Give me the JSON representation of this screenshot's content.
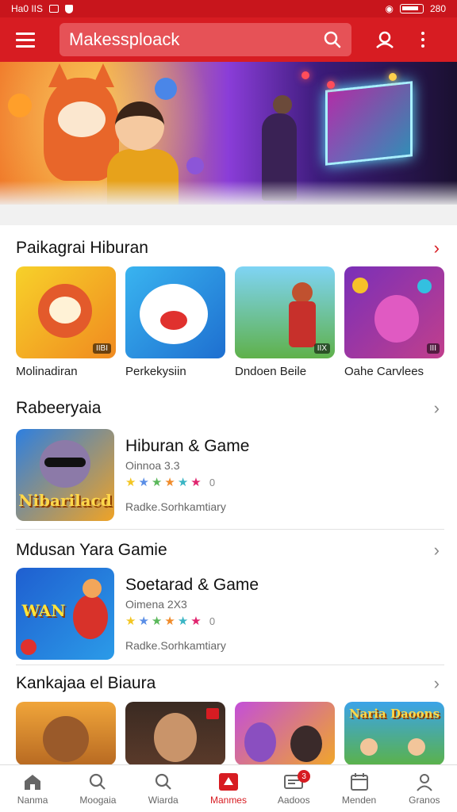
{
  "status_bar": {
    "left_text": "Ha0 IIS",
    "right_text": "280"
  },
  "search": {
    "text": "Makessploack"
  },
  "sections": [
    {
      "title": "Paikagrai Hiburan",
      "chevron_color": "#d71c22",
      "tiles": [
        {
          "label": "Molinadiran",
          "tag": "IIBI"
        },
        {
          "label": "Perkekysiin",
          "tag": ""
        },
        {
          "label": "Dndoen Beile",
          "tag": "IIX"
        },
        {
          "label": "Oahe Carvlees",
          "tag": "III"
        }
      ]
    },
    {
      "title": "Rabeeryaia",
      "item": {
        "title": "Hiburan & Game",
        "sub": "Oinnoa 3.3",
        "stars": "★★★★★★",
        "rating": "0",
        "meta": "Radke.Sorhkamtiary",
        "thumb_word": "Nibarilacd"
      }
    },
    {
      "title": "Mdusan Yara Gamie",
      "item": {
        "title": "Soetarad & Game",
        "sub": "Oimena 2X3",
        "stars": "★★★★★★",
        "rating": "0",
        "meta": "Radke.Sorhkamtiary",
        "thumb_word": "WAN"
      }
    },
    {
      "title": "Kankajaa el Biaura",
      "tiles": [
        {
          "label": ""
        },
        {
          "label": ""
        },
        {
          "label": ""
        },
        {
          "label": "",
          "word": "Naria Daoons"
        }
      ]
    }
  ],
  "bottom_nav": [
    {
      "label": "Nanma",
      "icon": "home-icon"
    },
    {
      "label": "Moogaia",
      "icon": "search-icon"
    },
    {
      "label": "Wiarda",
      "icon": "search-icon"
    },
    {
      "label": "Manmes",
      "icon": "games-icon",
      "active": true
    },
    {
      "label": "Aadoos",
      "icon": "inbox-icon",
      "badge": "3"
    },
    {
      "label": "Menden",
      "icon": "calendar-icon"
    },
    {
      "label": "Granos",
      "icon": "profile-icon"
    }
  ],
  "colors": {
    "brand_red": "#d71c22",
    "star_colors": [
      "#f3c623",
      "#5a8ee6",
      "#5bb85b",
      "#f08b2a",
      "#3ab5c4",
      "#e0246e"
    ]
  }
}
